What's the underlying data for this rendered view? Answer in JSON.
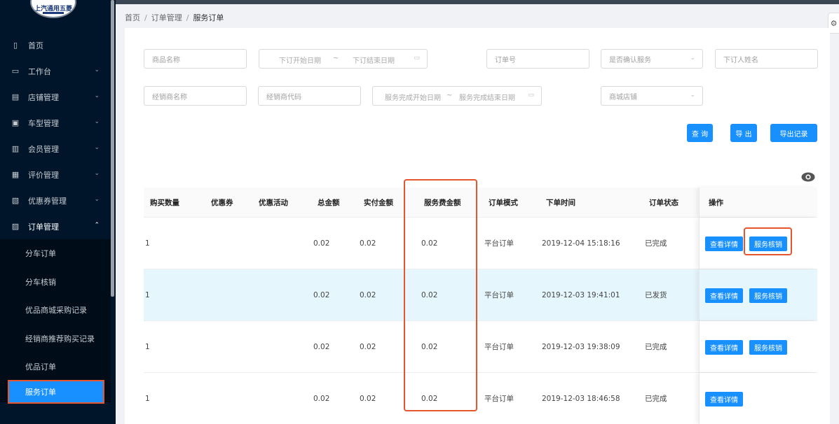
{
  "sidebar": {
    "logo_text": "上汽通用五菱",
    "menu": [
      {
        "label": "首页",
        "icon": "file-icon",
        "has_chevron": false
      },
      {
        "label": "工作台",
        "icon": "monitor-icon",
        "has_chevron": true
      },
      {
        "label": "店铺管理",
        "icon": "store-icon",
        "has_chevron": true
      },
      {
        "label": "车型管理",
        "icon": "card-icon",
        "has_chevron": true
      },
      {
        "label": "会员管理",
        "icon": "member-icon",
        "has_chevron": true
      },
      {
        "label": "评价管理",
        "icon": "list-icon",
        "has_chevron": true
      },
      {
        "label": "优惠券管理",
        "icon": "coupon-icon",
        "has_chevron": true
      },
      {
        "label": "订单管理",
        "icon": "order-icon",
        "has_chevron": true,
        "open": true
      }
    ],
    "submenu": [
      {
        "label": "分车订单"
      },
      {
        "label": "分车核销"
      },
      {
        "label": "优品商城采购记录"
      },
      {
        "label": "经销商推荐购买记录"
      },
      {
        "label": "优品订单"
      },
      {
        "label": "服务订单",
        "active": true
      }
    ]
  },
  "breadcrumb": {
    "items": [
      "首页",
      "订单管理",
      "服务订单"
    ],
    "separator": "/"
  },
  "filters": {
    "product_name": "商品名称",
    "order_start": "下订开始日期",
    "order_end": "下订结束日期",
    "range_sep": "~",
    "order_no": "订单号",
    "service_confirmed": "是否确认服务",
    "buyer_name": "下订人姓名",
    "dealer_name": "经销商名称",
    "dealer_code": "经销商代码",
    "service_start": "服务完成开始日期",
    "service_end": "服务完成结束日期",
    "mall_store": "商城店铺"
  },
  "buttons": {
    "query": "查 询",
    "export": "导 出",
    "export_log": "导出记录"
  },
  "table": {
    "columns": [
      "购买数量",
      "优惠券",
      "优惠活动",
      "总金额",
      "实付金额",
      "服务费金额",
      "订单模式",
      "下单时间",
      "订单状态",
      "操作"
    ],
    "rows": [
      {
        "qty": "1",
        "coupon": "",
        "promo": "",
        "total": "0.02",
        "paid": "0.02",
        "fee": "0.02",
        "mode": "平台订单",
        "time": "2019-12-04 15:18:16",
        "status": "已完成",
        "actions": [
          "查看详情",
          "服务核销"
        ]
      },
      {
        "qty": "1",
        "coupon": "",
        "promo": "",
        "total": "0.02",
        "paid": "0.02",
        "fee": "0.02",
        "mode": "平台订单",
        "time": "2019-12-03 19:41:01",
        "status": "已发货",
        "actions": [
          "查看详情",
          "服务核销"
        ]
      },
      {
        "qty": "1",
        "coupon": "",
        "promo": "",
        "total": "0.02",
        "paid": "0.02",
        "fee": "0.02",
        "mode": "平台订单",
        "time": "2019-12-03 19:38:09",
        "status": "已完成",
        "actions": [
          "查看详情",
          "服务核销"
        ]
      },
      {
        "qty": "1",
        "coupon": "",
        "promo": "",
        "total": "0.02",
        "paid": "0.02",
        "fee": "0.02",
        "mode": "平台订单",
        "time": "2019-12-03 18:46:58",
        "status": "已完成",
        "actions": [
          "查看详情"
        ]
      }
    ]
  },
  "colors": {
    "sidebar_bg": "#001529",
    "primary": "#1890ff",
    "highlight_box": "#e4572e",
    "row_hover": "#e6f6fd"
  }
}
